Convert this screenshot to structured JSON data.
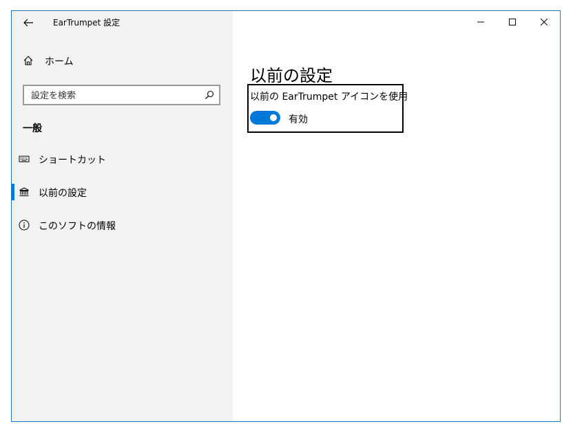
{
  "window": {
    "title": "EarTrumpet 設定",
    "accent_color": "#0078d7",
    "border_color": "#1979ca",
    "controls": [
      "minimize-icon",
      "maximize-icon",
      "close-icon"
    ]
  },
  "sidebar": {
    "background": "#f2f2f2",
    "back_icon": "arrow-left-icon",
    "home": {
      "label": "ホーム",
      "icon": "home-icon"
    },
    "search": {
      "placeholder": "設定を検索",
      "value": "",
      "icon": "search-icon"
    },
    "section_header": "一般",
    "items": [
      {
        "label": "ショートカット",
        "icon": "keyboard-icon",
        "selected": false
      },
      {
        "label": "以前の設定",
        "icon": "bank-icon",
        "selected": true
      },
      {
        "label": "このソフトの情報",
        "icon": "info-icon",
        "selected": false
      }
    ]
  },
  "main": {
    "title": "以前の設定",
    "setting": {
      "label": "以前の EarTrumpet アイコンを使用",
      "toggle_on": true,
      "state_label": "有効"
    }
  }
}
